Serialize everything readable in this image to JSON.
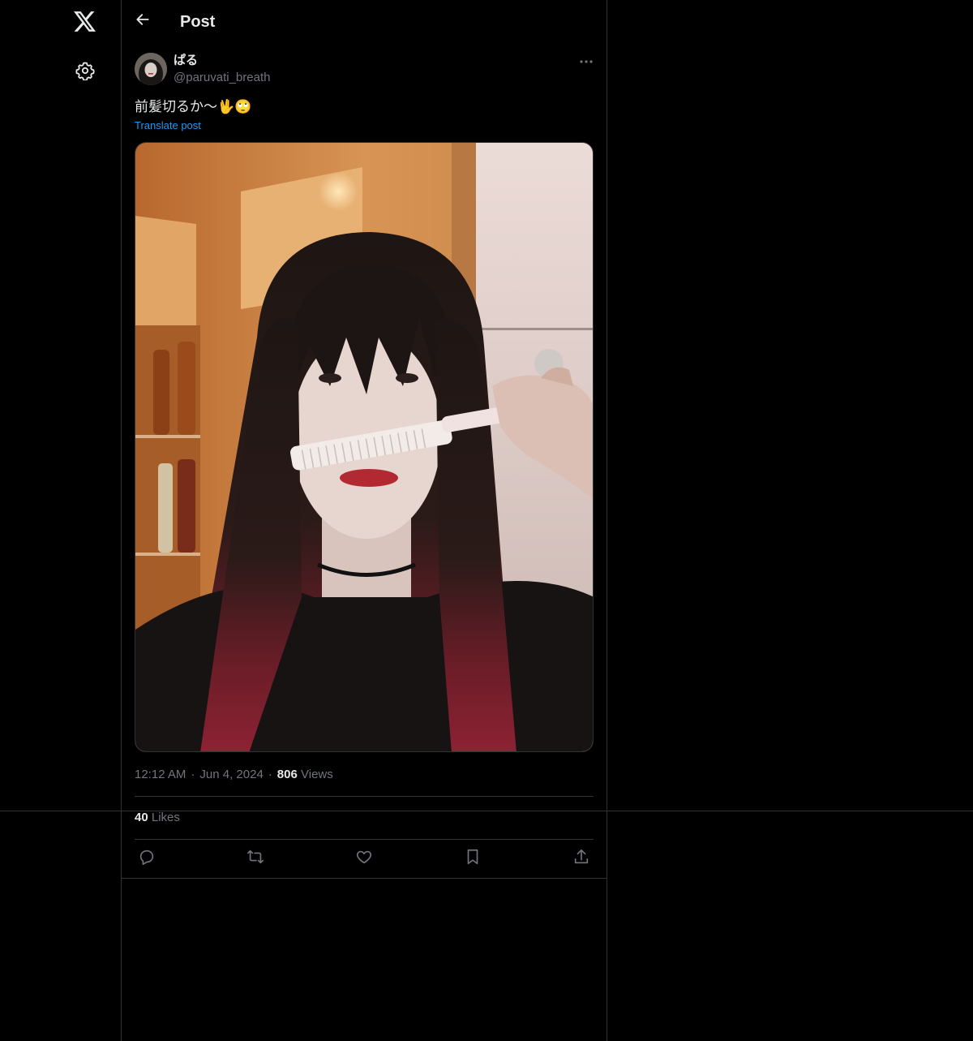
{
  "nav": {
    "logo_icon": "x-logo-icon",
    "settings_icon": "gear-icon"
  },
  "header": {
    "title": "Post",
    "back_icon": "arrow-left-icon"
  },
  "post": {
    "author": {
      "display_name": "ぱる",
      "handle": "@paruvati_breath"
    },
    "text": "前髪切るか〜🖖🙄",
    "translate_label": "Translate post",
    "time": "12:12 AM",
    "date": "Jun 4, 2024",
    "separator": "·",
    "views_count": "806",
    "views_label": "Views",
    "likes_count": "40",
    "likes_label": "Likes"
  },
  "actions": [
    {
      "name": "reply",
      "icon": "reply-icon"
    },
    {
      "name": "repost",
      "icon": "repost-icon"
    },
    {
      "name": "like",
      "icon": "heart-icon"
    },
    {
      "name": "bookmark",
      "icon": "bookmark-icon"
    },
    {
      "name": "share",
      "icon": "share-icon"
    }
  ],
  "colors": {
    "background": "#000000",
    "text": "#e7e9ea",
    "muted": "#71767b",
    "link": "#1d9bf0",
    "border": "#2f3336"
  }
}
